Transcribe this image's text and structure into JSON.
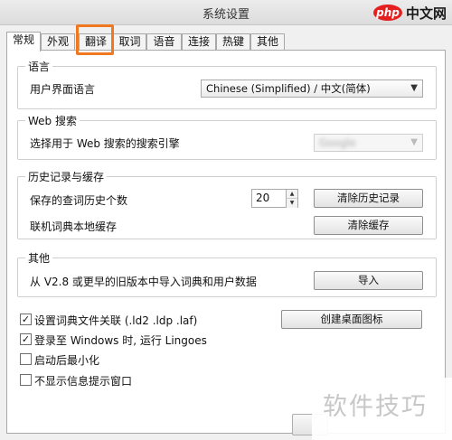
{
  "window": {
    "title": "系统设置"
  },
  "watermark_top": {
    "badge": "php",
    "text": "中文网"
  },
  "watermark_bottom": {
    "text": "软件技巧"
  },
  "tabs": [
    {
      "label": "常规"
    },
    {
      "label": "外观"
    },
    {
      "label": "翻译"
    },
    {
      "label": "取词"
    },
    {
      "label": "语音"
    },
    {
      "label": "连接"
    },
    {
      "label": "热键"
    },
    {
      "label": "其他"
    }
  ],
  "active_tab": "常规",
  "highlighted_tab": "翻译",
  "highlight_color": "#f07820",
  "language": {
    "group_title": "语言",
    "ui_language_label": "用户界面语言",
    "ui_language_value": "Chinese (Simplified)  /  中文(简体)"
  },
  "web_search": {
    "group_title": "Web 搜索",
    "engine_label": "选择用于 Web 搜索的搜索引擎",
    "engine_value": "Google"
  },
  "history": {
    "group_title": "历史记录与缓存",
    "count_label": "保存的查词历史个数",
    "count_value": "20",
    "clear_history_button": "清除历史记录",
    "cache_label": "联机词典本地缓存",
    "clear_cache_button": "清除缓存"
  },
  "other": {
    "group_title": "其他",
    "import_label": "从 V2.8 或更早的旧版本中导入词典和用户数据",
    "import_button": "导入"
  },
  "options": {
    "assoc_label": "设置词典文件关联 (.ld2 .ldp .laf)",
    "assoc_checked": true,
    "startup_label": "登录至 Windows 时, 运行 Lingoes",
    "startup_checked": true,
    "minimize_label": "启动后最小化",
    "minimize_checked": false,
    "notify_label": "不显示信息提示窗口",
    "notify_checked": false,
    "desktop_icon_button": "创建桌面图标"
  }
}
